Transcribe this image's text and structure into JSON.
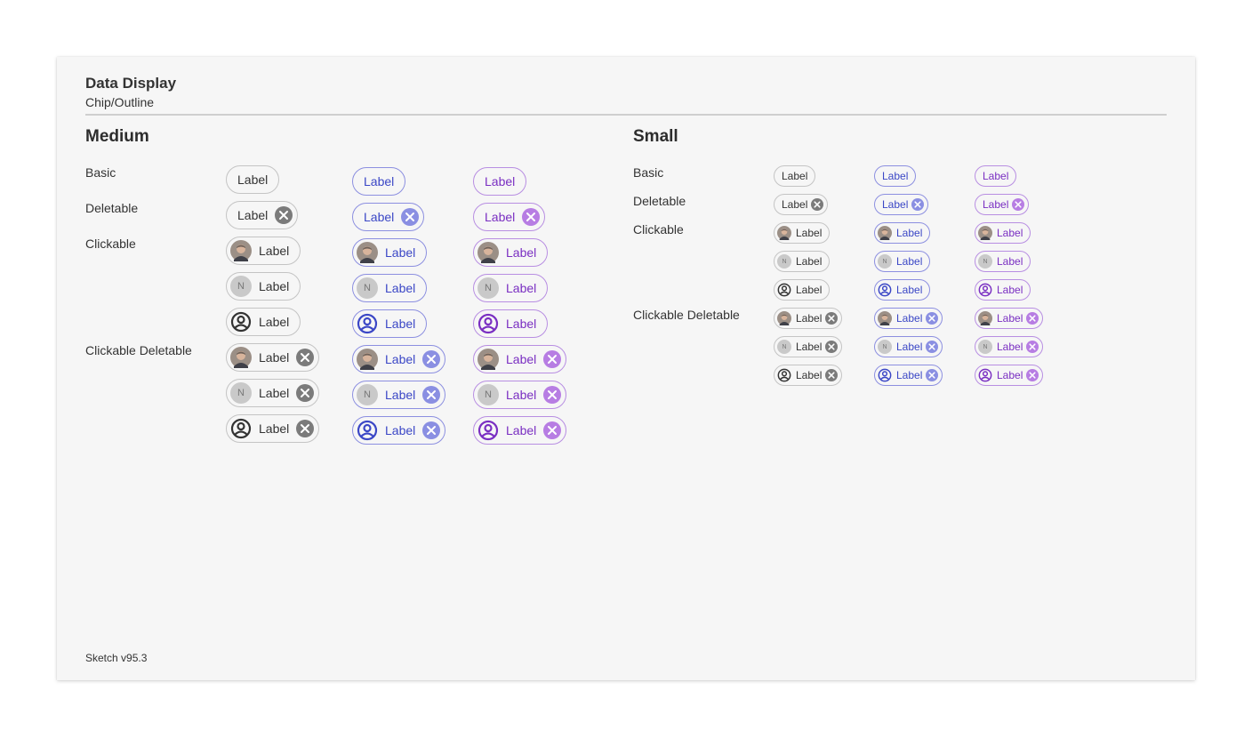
{
  "header": {
    "title": "Data Display",
    "subtitle": "Chip/Outline"
  },
  "sections": {
    "medium": "Medium",
    "small": "Small"
  },
  "rows": {
    "basic": "Basic",
    "deletable": "Deletable",
    "clickable": "Clickable",
    "clickable_deletable": "Clickable Deletable"
  },
  "chip": {
    "label": "Label",
    "avatar_letter": "N"
  },
  "variants": [
    "neutral",
    "blue",
    "purple"
  ],
  "colors": {
    "neutral_border": "#c4c4c4",
    "neutral_text": "#333333",
    "blue_border": "#8c8fe0",
    "blue_text": "#3b47c6",
    "purple_border": "#b88ee2",
    "purple_text": "#7a2fc2",
    "background": "#f6f6f6"
  },
  "icons": {
    "photo_avatar": "person-photo-avatar",
    "letter_avatar": "letter-avatar",
    "user_avatar": "account-circle-icon",
    "delete": "close-circle-icon"
  },
  "footer": "Sketch v95.3"
}
